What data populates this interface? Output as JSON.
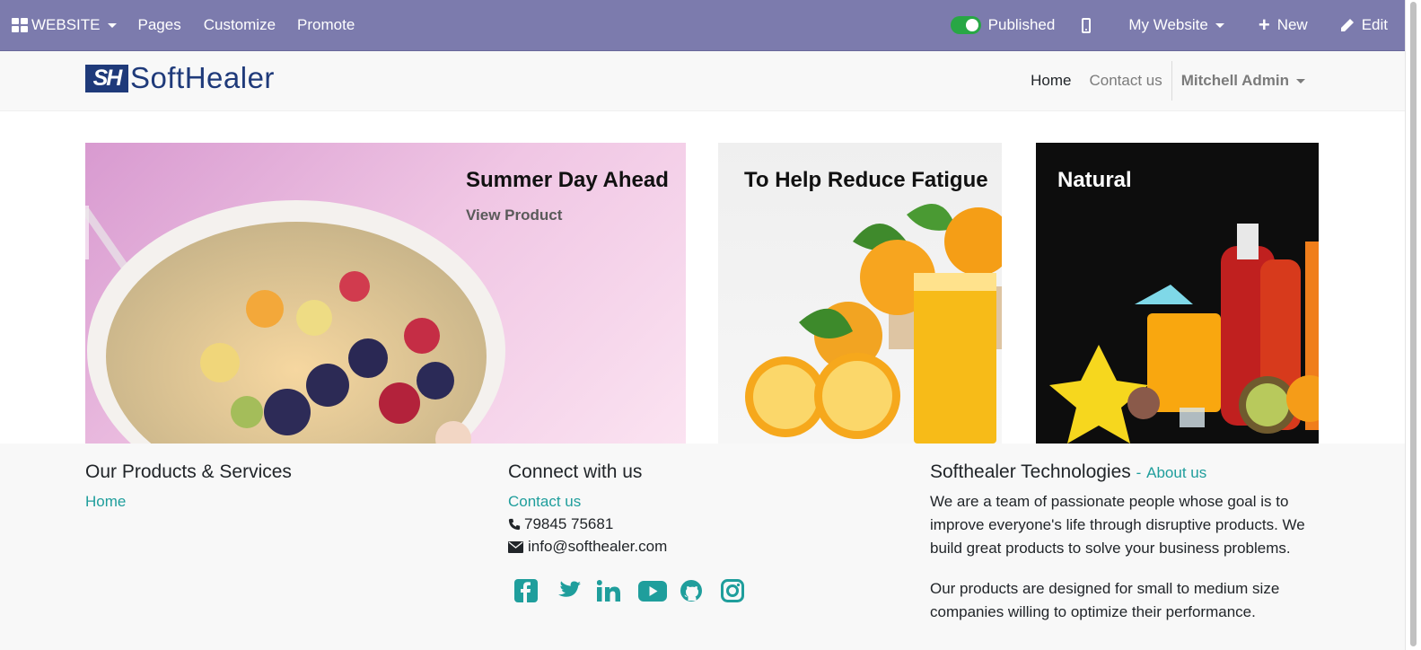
{
  "adminbar": {
    "website_label": "WEBSITE",
    "menu": [
      "Pages",
      "Customize",
      "Promote"
    ],
    "published_label": "Published",
    "my_website_label": "My Website",
    "new_label": "New",
    "edit_label": "Edit"
  },
  "header": {
    "logo_mark": "SH",
    "logo_text": "SoftHealer",
    "nav": {
      "home": "Home",
      "contact": "Contact us",
      "user": "Mitchell Admin"
    }
  },
  "cards": [
    {
      "title": "Summer Day Ahead",
      "link": "View Product"
    },
    {
      "title": "To Help Reduce Fatigue"
    },
    {
      "title": "Natural"
    }
  ],
  "footer": {
    "col1": {
      "title": "Our Products & Services",
      "link": "Home"
    },
    "col2": {
      "title": "Connect with us",
      "contact": "Contact us",
      "phone": "79845 75681",
      "email": "info@softhealer.com",
      "social": [
        "facebook-icon",
        "twitter-icon",
        "linkedin-icon",
        "youtube-icon",
        "github-icon",
        "instagram-icon"
      ]
    },
    "col3": {
      "title": "Softhealer Technologies",
      "separator": "-",
      "about": "About us",
      "p1": "We are a team of passionate people whose goal is to improve everyone's life through disruptive products. We build great products to solve your business problems.",
      "p2": "Our products are designed for small to medium size companies willing to optimize their performance."
    }
  },
  "colors": {
    "adminbar": "#7c7bad",
    "link": "#1f9e9c",
    "toggle": "#28a745",
    "brand": "#1f3a7a"
  }
}
